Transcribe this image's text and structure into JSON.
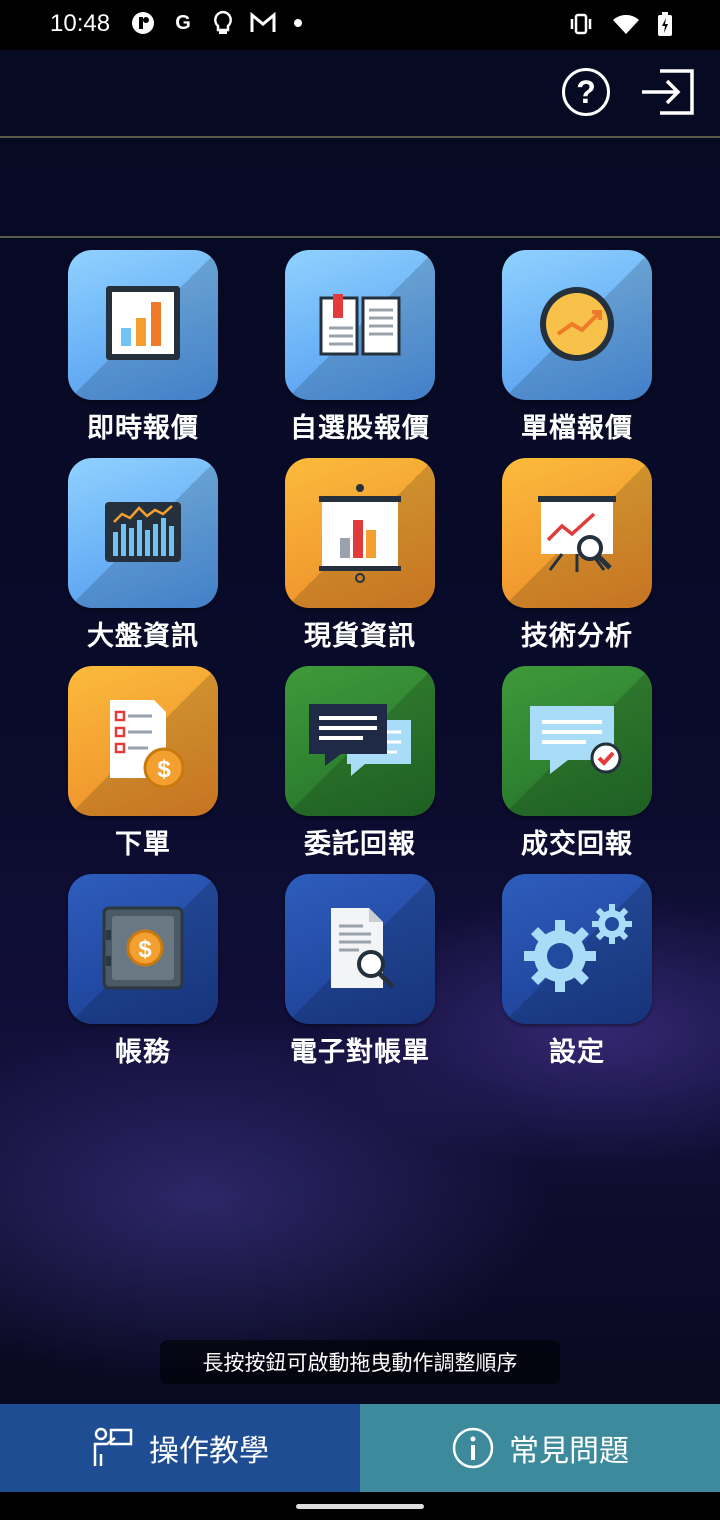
{
  "status_bar": {
    "time": "10:48",
    "left_icons": [
      "app-icon",
      "google-icon",
      "lightbulb-icon",
      "gmail-icon",
      "dot-icon"
    ],
    "right_icons": [
      "vibrate-icon",
      "wifi-icon",
      "battery-icon"
    ]
  },
  "header": {
    "help_glyph": "?",
    "help_icon": "help-circle-icon",
    "logout_icon": "logout-icon"
  },
  "menu": {
    "items": [
      {
        "label": "即時報價",
        "icon": "bar-chart-icon",
        "color": "blue"
      },
      {
        "label": "自選股報價",
        "icon": "open-book-icon",
        "color": "blue"
      },
      {
        "label": "單檔報價",
        "icon": "trend-circle-icon",
        "color": "blue"
      },
      {
        "label": "大盤資訊",
        "icon": "market-chart-icon",
        "color": "blue"
      },
      {
        "label": "現貨資訊",
        "icon": "presentation-icon",
        "color": "orange"
      },
      {
        "label": "技術分析",
        "icon": "analysis-board-icon",
        "color": "orange"
      },
      {
        "label": "下單",
        "icon": "order-checklist-icon",
        "color": "orange"
      },
      {
        "label": "委託回報",
        "icon": "chat-bubbles-icon",
        "color": "green"
      },
      {
        "label": "成交回報",
        "icon": "chat-check-icon",
        "color": "green"
      },
      {
        "label": "帳務",
        "icon": "safe-icon",
        "color": "navy"
      },
      {
        "label": "電子對帳單",
        "icon": "document-search-icon",
        "color": "navy"
      },
      {
        "label": "設定",
        "icon": "gears-icon",
        "color": "navy"
      }
    ]
  },
  "hint_text": "長按按鈕可啟動拖曳動作調整順序",
  "bottom_nav": {
    "tutorial_label": "操作教學",
    "tutorial_icon": "presenter-icon",
    "faq_label": "常見問題",
    "faq_icon": "info-circle-icon"
  },
  "colors": {
    "tile_blue": "#5aa6f2",
    "tile_orange": "#f2a030",
    "tile_green": "#2f8633",
    "tile_navy": "#224a9f",
    "nav_left": "#1e4d93",
    "nav_right": "#3c8a9c"
  }
}
